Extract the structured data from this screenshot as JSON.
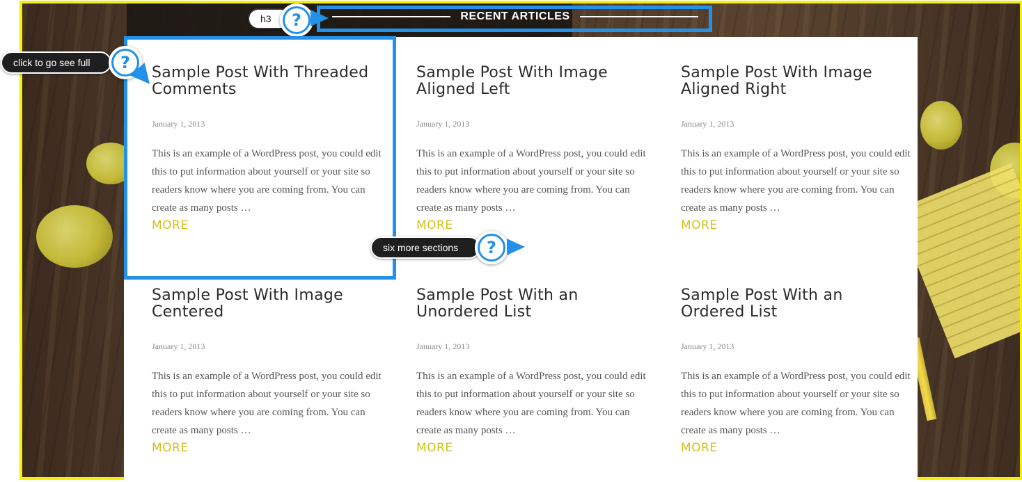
{
  "section": {
    "title": "RECENT ARTICLES"
  },
  "posts": [
    {
      "title": "Sample Post With Threaded Comments",
      "date": "January 1, 2013",
      "excerpt": "This is an example of a WordPress post, you could edit this to put information about yourself or your site so readers know where you are coming from. You can create as many posts …",
      "more": "MORE"
    },
    {
      "title": "Sample Post With Image Aligned Left",
      "date": "January 1, 2013",
      "excerpt": "This is an example of a WordPress post, you could edit this to put information about yourself or your site so readers know where you are coming from. You can create as many posts …",
      "more": "MORE"
    },
    {
      "title": "Sample Post With Image Aligned Right",
      "date": "January 1, 2013",
      "excerpt": "This is an example of a WordPress post, you could edit this to put information about yourself or your site so readers know where you are coming from. You can create as many posts …",
      "more": "MORE"
    },
    {
      "title": "Sample Post With Image Centered",
      "date": "January 1, 2013",
      "excerpt": "This is an example of a WordPress post, you could edit this to put information about yourself or your site so readers know where you are coming from. You can create as many posts …",
      "more": "MORE"
    },
    {
      "title": "Sample Post With an Unordered List",
      "date": "January 1, 2013",
      "excerpt": "This is an example of a WordPress post, you could edit this to put information about yourself or your site so readers know where you are coming from. You can create as many posts …",
      "more": "MORE"
    },
    {
      "title": "Sample Post With an Ordered List",
      "date": "January 1, 2013",
      "excerpt": "This is an example of a WordPress post, you could edit this to put information about yourself or your site so readers know where you are coming from. You can create as many posts …",
      "more": "MORE"
    }
  ],
  "annotations": {
    "heading_tag": "h3",
    "click_tip": "click to go see full",
    "sections_tip": "six more sections",
    "icon": "help-icon",
    "icon_glyph": "?"
  },
  "colors": {
    "frame": "#f7f000",
    "highlight": "#2391e8",
    "more_link": "#d3c21a"
  }
}
